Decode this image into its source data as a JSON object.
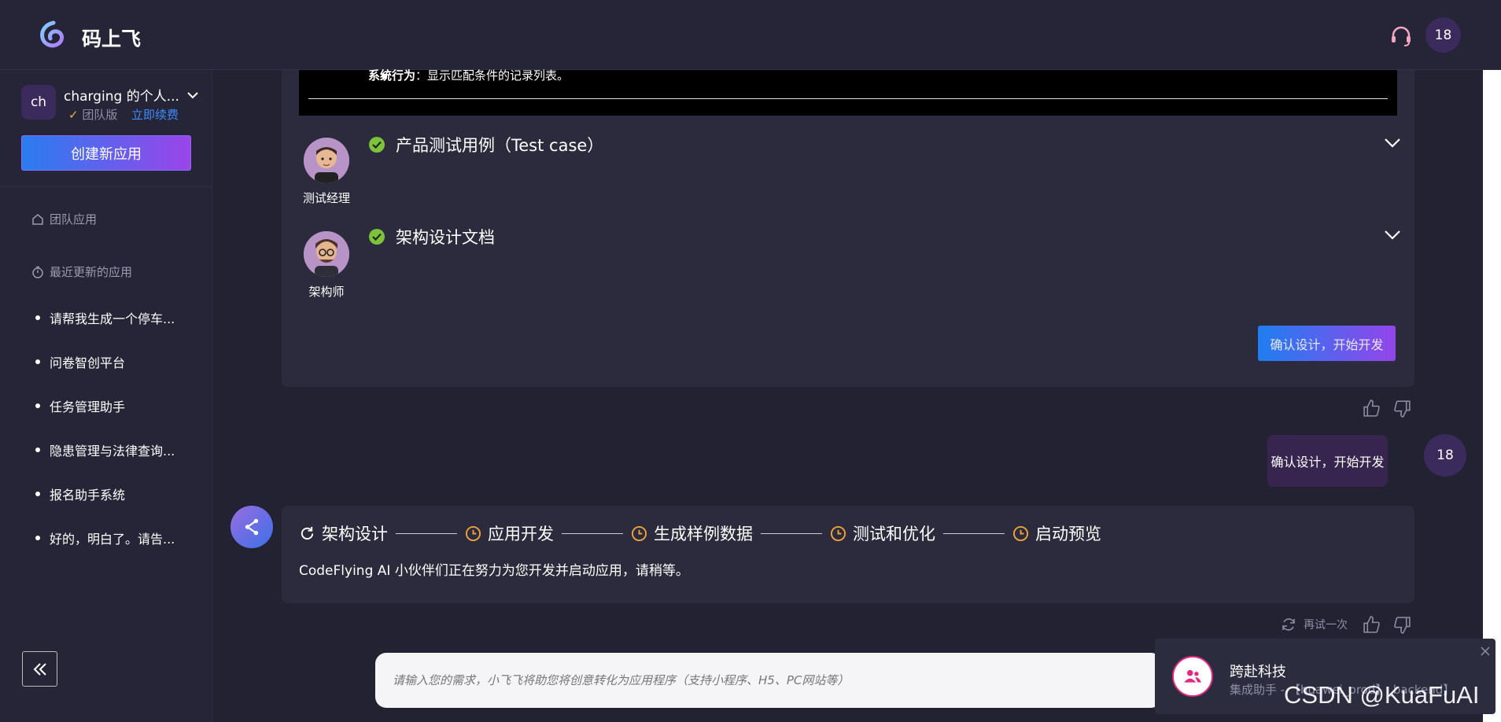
{
  "header": {
    "brand": "码上飞",
    "avatar": "18"
  },
  "sidebar": {
    "team": {
      "avatar": "ch",
      "name": "charging 的个人...",
      "edition": "团队版",
      "renew": "立即续费"
    },
    "create_button": "创建新应用",
    "team_apps": "团队应用",
    "recent_apps": "最近更新的应用",
    "items": [
      {
        "label": "请帮我生成一个停车..."
      },
      {
        "label": "问卷智创平台"
      },
      {
        "label": "任务管理助手"
      },
      {
        "label": "隐患管理与法律查询..."
      },
      {
        "label": "报名助手系统"
      },
      {
        "label": "好的，明白了。请告..."
      }
    ]
  },
  "chat": {
    "doc_snippet": {
      "bold": "系统行为",
      "text": "：显示匹配条件的记录列表。"
    },
    "roles": [
      {
        "name": "测试经理",
        "doc": "产品测试用例（Test case）"
      },
      {
        "name": "架构师",
        "doc": "架构设计文档"
      }
    ],
    "confirm_button": "确认设计，开始开发",
    "user_message": "确认设计，开始开发",
    "user_avatar": "18",
    "steps": [
      "架构设计",
      "应用开发",
      "生成样例数据",
      "测试和优化",
      "启动预览"
    ],
    "status_message": "CodeFlying AI 小伙伴们正在努力为您开发并启动应用，请稍等。",
    "retry": "再试一次"
  },
  "input": {
    "placeholder": "请输入您的需求，小飞飞将助您将创意转化为应用程序（支持小程序、H5、PC网站等）"
  },
  "toast": {
    "title": "跨赴科技",
    "subtitle": "集成助手 - 【huawei_prod】_backend】"
  },
  "watermark": "CSDN @KuaFuAI",
  "colors": {
    "accent_blue": "#1e7ef0",
    "accent_purple": "#9445ea",
    "check_green": "#7cc23c",
    "pending_orange": "#f0a23c"
  }
}
